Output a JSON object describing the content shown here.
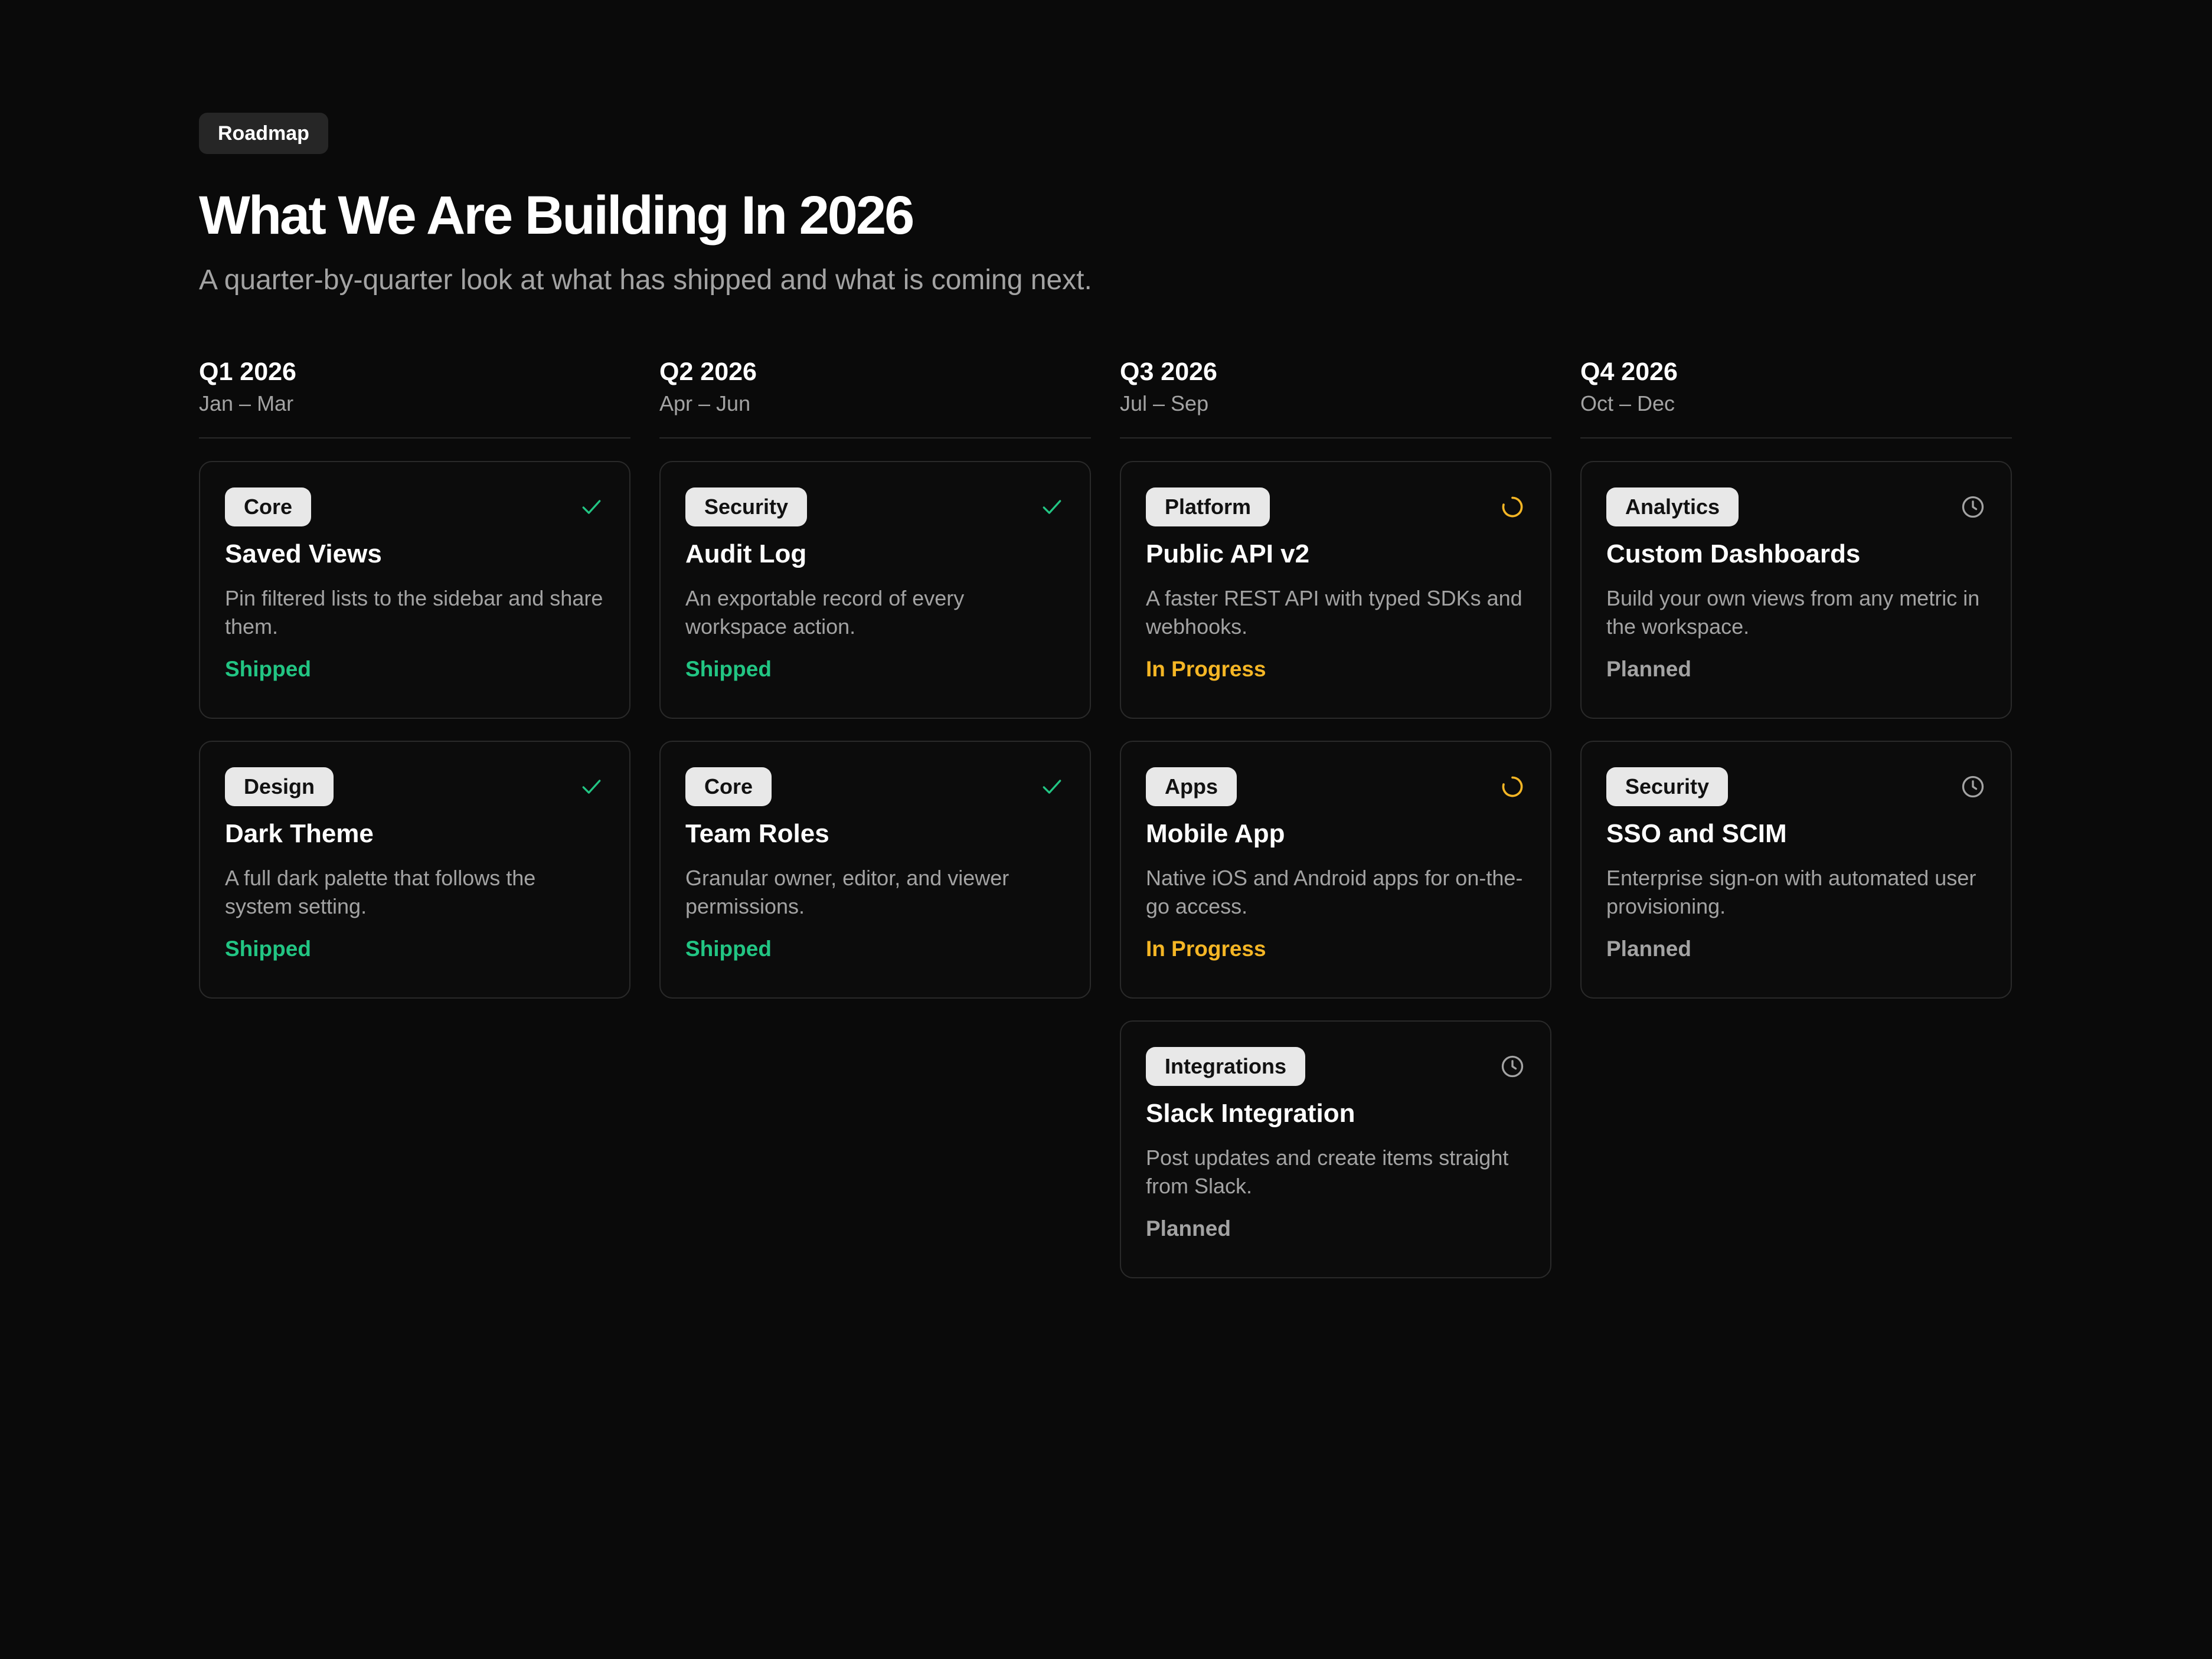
{
  "header": {
    "eyebrow": "Roadmap",
    "title": "What We Are Building In 2026",
    "subtitle": "A quarter-by-quarter look at what has shipped and what is coming next."
  },
  "colors": {
    "background": "#0a0a0a",
    "shipped": "#22c583",
    "in_progress": "#f5b625",
    "planned": "#a3a3a3"
  },
  "columns": [
    {
      "quarter": "Q1 2026",
      "range": "Jan – Mar",
      "cards": [
        {
          "tag": "Core",
          "title": "Saved Views",
          "description": "Pin filtered lists to the sidebar and share them.",
          "status": "Shipped",
          "status_icon": "check-icon"
        },
        {
          "tag": "Design",
          "title": "Dark Theme",
          "description": "A full dark palette that follows the system setting.",
          "status": "Shipped",
          "status_icon": "check-icon"
        }
      ]
    },
    {
      "quarter": "Q2 2026",
      "range": "Apr – Jun",
      "cards": [
        {
          "tag": "Security",
          "title": "Audit Log",
          "description": "An exportable record of every workspace action.",
          "status": "Shipped",
          "status_icon": "check-icon"
        },
        {
          "tag": "Core",
          "title": "Team Roles",
          "description": "Granular owner, editor, and viewer permissions.",
          "status": "Shipped",
          "status_icon": "check-icon"
        }
      ]
    },
    {
      "quarter": "Q3 2026",
      "range": "Jul – Sep",
      "cards": [
        {
          "tag": "Platform",
          "title": "Public API v2",
          "description": "A faster REST API with typed SDKs and webhooks.",
          "status": "In Progress",
          "status_icon": "spinner-icon"
        },
        {
          "tag": "Apps",
          "title": "Mobile App",
          "description": "Native iOS and Android apps for on-the-go access.",
          "status": "In Progress",
          "status_icon": "spinner-icon"
        },
        {
          "tag": "Integrations",
          "title": "Slack Integration",
          "description": "Post updates and create items straight from Slack.",
          "status": "Planned",
          "status_icon": "clock-icon"
        }
      ]
    },
    {
      "quarter": "Q4 2026",
      "range": "Oct – Dec",
      "cards": [
        {
          "tag": "Analytics",
          "title": "Custom Dashboards",
          "description": "Build your own views from any metric in the workspace.",
          "status": "Planned",
          "status_icon": "clock-icon"
        },
        {
          "tag": "Security",
          "title": "SSO and SCIM",
          "description": "Enterprise sign-on with automated user provisioning.",
          "status": "Planned",
          "status_icon": "clock-icon"
        }
      ]
    }
  ]
}
